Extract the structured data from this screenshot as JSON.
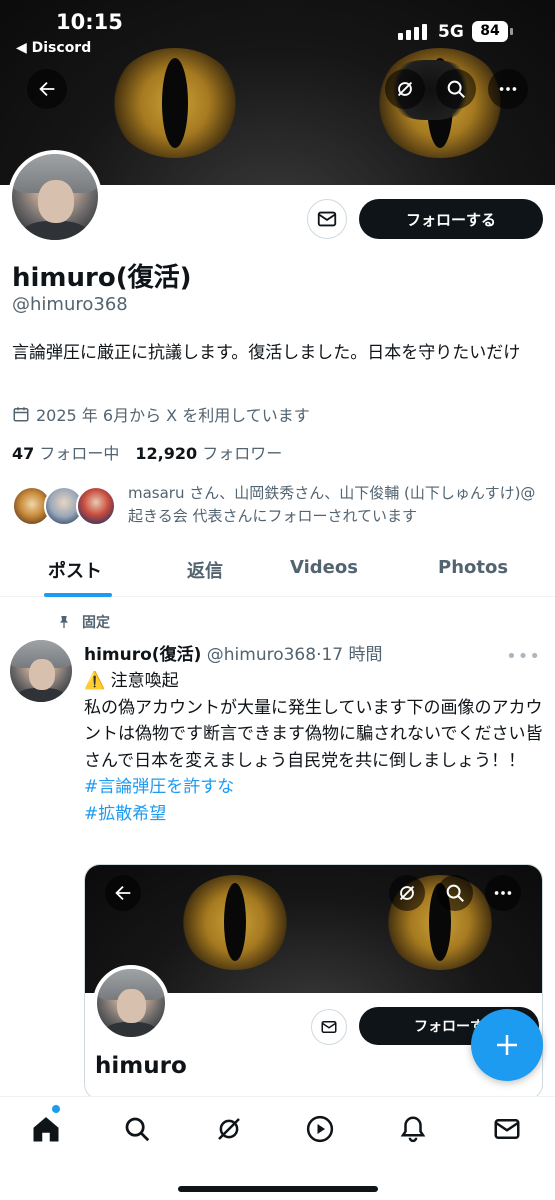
{
  "status_bar": {
    "time": "10:15",
    "back_app": "◀ Discord",
    "network": "5G",
    "battery": "84"
  },
  "profile": {
    "name": "himuro(復活)",
    "handle": "@himuro368",
    "bio": "言論弾圧に厳正に抗議します。復活しました。日本を守りたいだけ",
    "joined": "2025 年 6月から X を利用しています",
    "following_count": "47",
    "following_label": "フォロー中",
    "followers_count": "12,920",
    "followers_label": "フォロワー",
    "followed_by": "masaru さん、山岡鉄秀さん、山下俊輔 (山下しゅんすけ)@起きる会 代表さんにフォローされています",
    "follow_button": "フォローする"
  },
  "tabs": [
    "ポスト",
    "返信",
    "Videos",
    "Photos"
  ],
  "post": {
    "pinned_label": "固定",
    "author_name": "himuro(復活)",
    "author_handle": "@himuro368",
    "time": "·17 時間",
    "text_line1": "⚠️ 注意喚起",
    "text_body": "私の偽アカウントが大量に発生しています下の画像のアカウントは偽物です断言できます偽物に騙されないでください皆さんで日本を変えましょう自民党を共に倒しましょう！！",
    "hashtags": [
      "#言論弾圧を許すな",
      "#拡散希望"
    ]
  },
  "embed": {
    "name": "himuro",
    "follow_button": "フォローす"
  },
  "colors": {
    "accent": "#1d9bf0",
    "text": "#0f1419",
    "secondary": "#536471"
  }
}
